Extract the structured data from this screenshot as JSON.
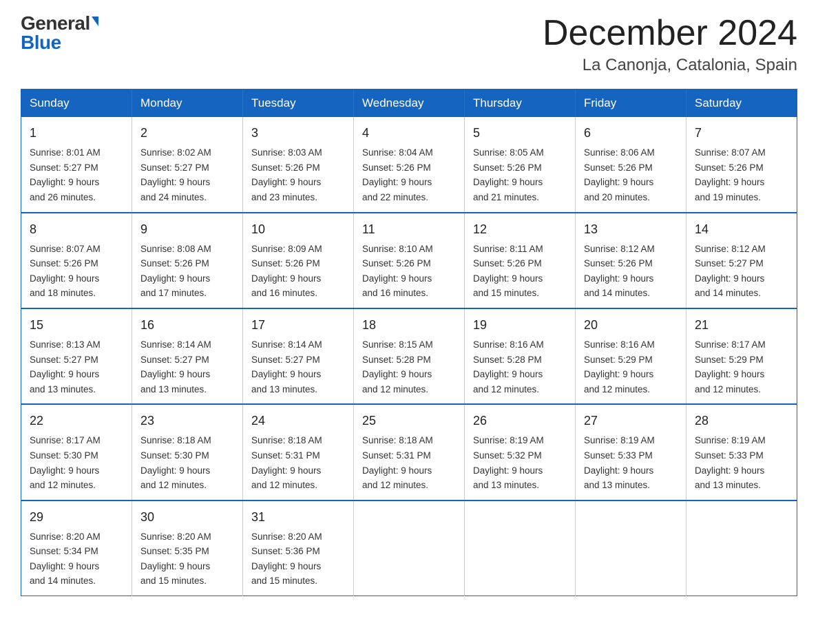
{
  "logo": {
    "general": "General",
    "blue": "Blue"
  },
  "title": "December 2024",
  "subtitle": "La Canonja, Catalonia, Spain",
  "weekdays": [
    "Sunday",
    "Monday",
    "Tuesday",
    "Wednesday",
    "Thursday",
    "Friday",
    "Saturday"
  ],
  "weeks": [
    [
      {
        "day": "1",
        "sunrise": "8:01 AM",
        "sunset": "5:27 PM",
        "daylight": "9 hours and 26 minutes."
      },
      {
        "day": "2",
        "sunrise": "8:02 AM",
        "sunset": "5:27 PM",
        "daylight": "9 hours and 24 minutes."
      },
      {
        "day": "3",
        "sunrise": "8:03 AM",
        "sunset": "5:26 PM",
        "daylight": "9 hours and 23 minutes."
      },
      {
        "day": "4",
        "sunrise": "8:04 AM",
        "sunset": "5:26 PM",
        "daylight": "9 hours and 22 minutes."
      },
      {
        "day": "5",
        "sunrise": "8:05 AM",
        "sunset": "5:26 PM",
        "daylight": "9 hours and 21 minutes."
      },
      {
        "day": "6",
        "sunrise": "8:06 AM",
        "sunset": "5:26 PM",
        "daylight": "9 hours and 20 minutes."
      },
      {
        "day": "7",
        "sunrise": "8:07 AM",
        "sunset": "5:26 PM",
        "daylight": "9 hours and 19 minutes."
      }
    ],
    [
      {
        "day": "8",
        "sunrise": "8:07 AM",
        "sunset": "5:26 PM",
        "daylight": "9 hours and 18 minutes."
      },
      {
        "day": "9",
        "sunrise": "8:08 AM",
        "sunset": "5:26 PM",
        "daylight": "9 hours and 17 minutes."
      },
      {
        "day": "10",
        "sunrise": "8:09 AM",
        "sunset": "5:26 PM",
        "daylight": "9 hours and 16 minutes."
      },
      {
        "day": "11",
        "sunrise": "8:10 AM",
        "sunset": "5:26 PM",
        "daylight": "9 hours and 16 minutes."
      },
      {
        "day": "12",
        "sunrise": "8:11 AM",
        "sunset": "5:26 PM",
        "daylight": "9 hours and 15 minutes."
      },
      {
        "day": "13",
        "sunrise": "8:12 AM",
        "sunset": "5:26 PM",
        "daylight": "9 hours and 14 minutes."
      },
      {
        "day": "14",
        "sunrise": "8:12 AM",
        "sunset": "5:27 PM",
        "daylight": "9 hours and 14 minutes."
      }
    ],
    [
      {
        "day": "15",
        "sunrise": "8:13 AM",
        "sunset": "5:27 PM",
        "daylight": "9 hours and 13 minutes."
      },
      {
        "day": "16",
        "sunrise": "8:14 AM",
        "sunset": "5:27 PM",
        "daylight": "9 hours and 13 minutes."
      },
      {
        "day": "17",
        "sunrise": "8:14 AM",
        "sunset": "5:27 PM",
        "daylight": "9 hours and 13 minutes."
      },
      {
        "day": "18",
        "sunrise": "8:15 AM",
        "sunset": "5:28 PM",
        "daylight": "9 hours and 12 minutes."
      },
      {
        "day": "19",
        "sunrise": "8:16 AM",
        "sunset": "5:28 PM",
        "daylight": "9 hours and 12 minutes."
      },
      {
        "day": "20",
        "sunrise": "8:16 AM",
        "sunset": "5:29 PM",
        "daylight": "9 hours and 12 minutes."
      },
      {
        "day": "21",
        "sunrise": "8:17 AM",
        "sunset": "5:29 PM",
        "daylight": "9 hours and 12 minutes."
      }
    ],
    [
      {
        "day": "22",
        "sunrise": "8:17 AM",
        "sunset": "5:30 PM",
        "daylight": "9 hours and 12 minutes."
      },
      {
        "day": "23",
        "sunrise": "8:18 AM",
        "sunset": "5:30 PM",
        "daylight": "9 hours and 12 minutes."
      },
      {
        "day": "24",
        "sunrise": "8:18 AM",
        "sunset": "5:31 PM",
        "daylight": "9 hours and 12 minutes."
      },
      {
        "day": "25",
        "sunrise": "8:18 AM",
        "sunset": "5:31 PM",
        "daylight": "9 hours and 12 minutes."
      },
      {
        "day": "26",
        "sunrise": "8:19 AM",
        "sunset": "5:32 PM",
        "daylight": "9 hours and 13 minutes."
      },
      {
        "day": "27",
        "sunrise": "8:19 AM",
        "sunset": "5:33 PM",
        "daylight": "9 hours and 13 minutes."
      },
      {
        "day": "28",
        "sunrise": "8:19 AM",
        "sunset": "5:33 PM",
        "daylight": "9 hours and 13 minutes."
      }
    ],
    [
      {
        "day": "29",
        "sunrise": "8:20 AM",
        "sunset": "5:34 PM",
        "daylight": "9 hours and 14 minutes."
      },
      {
        "day": "30",
        "sunrise": "8:20 AM",
        "sunset": "5:35 PM",
        "daylight": "9 hours and 15 minutes."
      },
      {
        "day": "31",
        "sunrise": "8:20 AM",
        "sunset": "5:36 PM",
        "daylight": "9 hours and 15 minutes."
      },
      null,
      null,
      null,
      null
    ]
  ],
  "labels": {
    "sunrise": "Sunrise:",
    "sunset": "Sunset:",
    "daylight": "Daylight:"
  }
}
